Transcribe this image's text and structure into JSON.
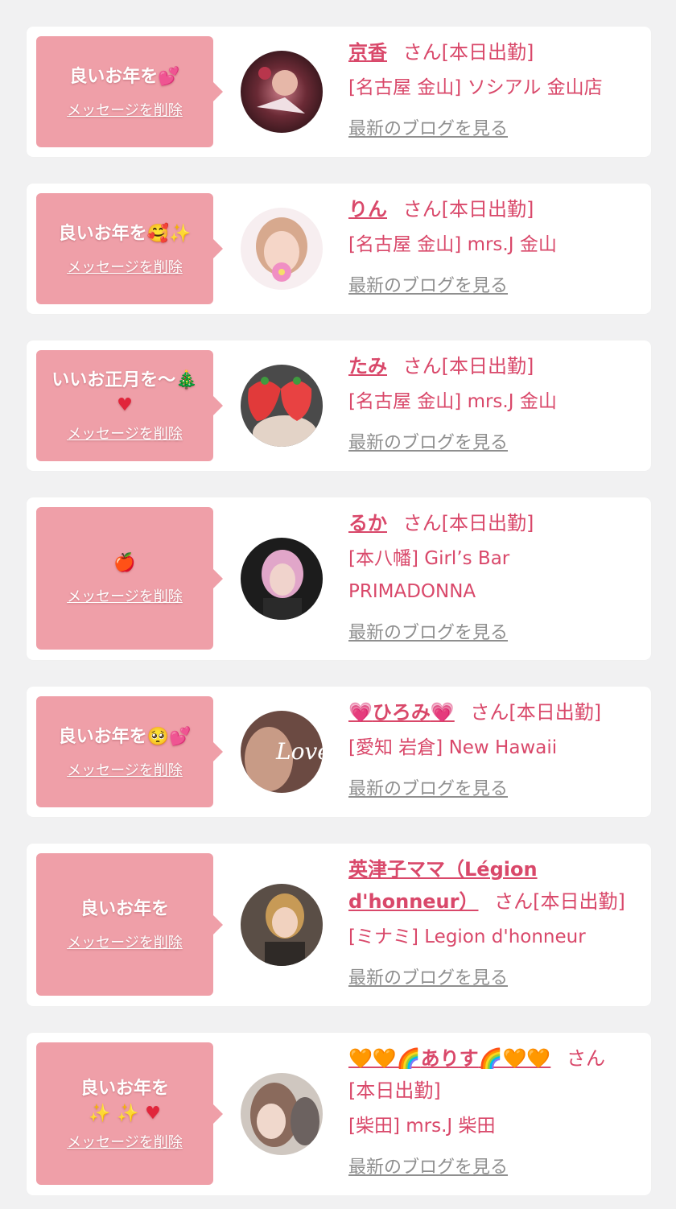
{
  "common": {
    "delete_label": "メッセージを削除",
    "san_suffix": "さん[本日出勤]",
    "san_only": "さん",
    "working_today": "[本日出勤]",
    "blog_link": "最新のブログを見る"
  },
  "items": [
    {
      "message": "良いお年を",
      "message_emoji": "💕",
      "name": "京香",
      "shop": "[名古屋 金山] ソシアル 金山店"
    },
    {
      "message": "良いお年を",
      "message_emoji": "🥰✨",
      "name": "りん",
      "shop": "[名古屋 金山] mrs.J 金山"
    },
    {
      "message": "いいお正月を〜",
      "message_emoji": "🎄",
      "message_line2": "♥",
      "name": "たみ",
      "shop": "[名古屋 金山] mrs.J 金山"
    },
    {
      "message": "",
      "message_emoji": "🍎",
      "name": "るか",
      "shop": "[本八幡] Girl’s Bar PRIMADONNA"
    },
    {
      "message": "良いお年を",
      "message_emoji": "🥺💕",
      "name_prefix": "💗",
      "name": "ひろみ",
      "name_suffix": "💗",
      "shop": "[愛知 岩倉] New Hawaii"
    },
    {
      "message": "良いお年を",
      "message_emoji": "",
      "name": "英津子ママ（Légion d'honneur）",
      "shop": "[ミナミ] Legion d'honneur"
    },
    {
      "message": "良いお年を",
      "message_emoji": "",
      "message_line2": "✨ ✨ ♥",
      "name_prefix": "🧡🧡🌈",
      "name": "ありす",
      "name_suffix": "🌈🧡🧡",
      "shop": "[柴田] mrs.J 柴田"
    }
  ]
}
